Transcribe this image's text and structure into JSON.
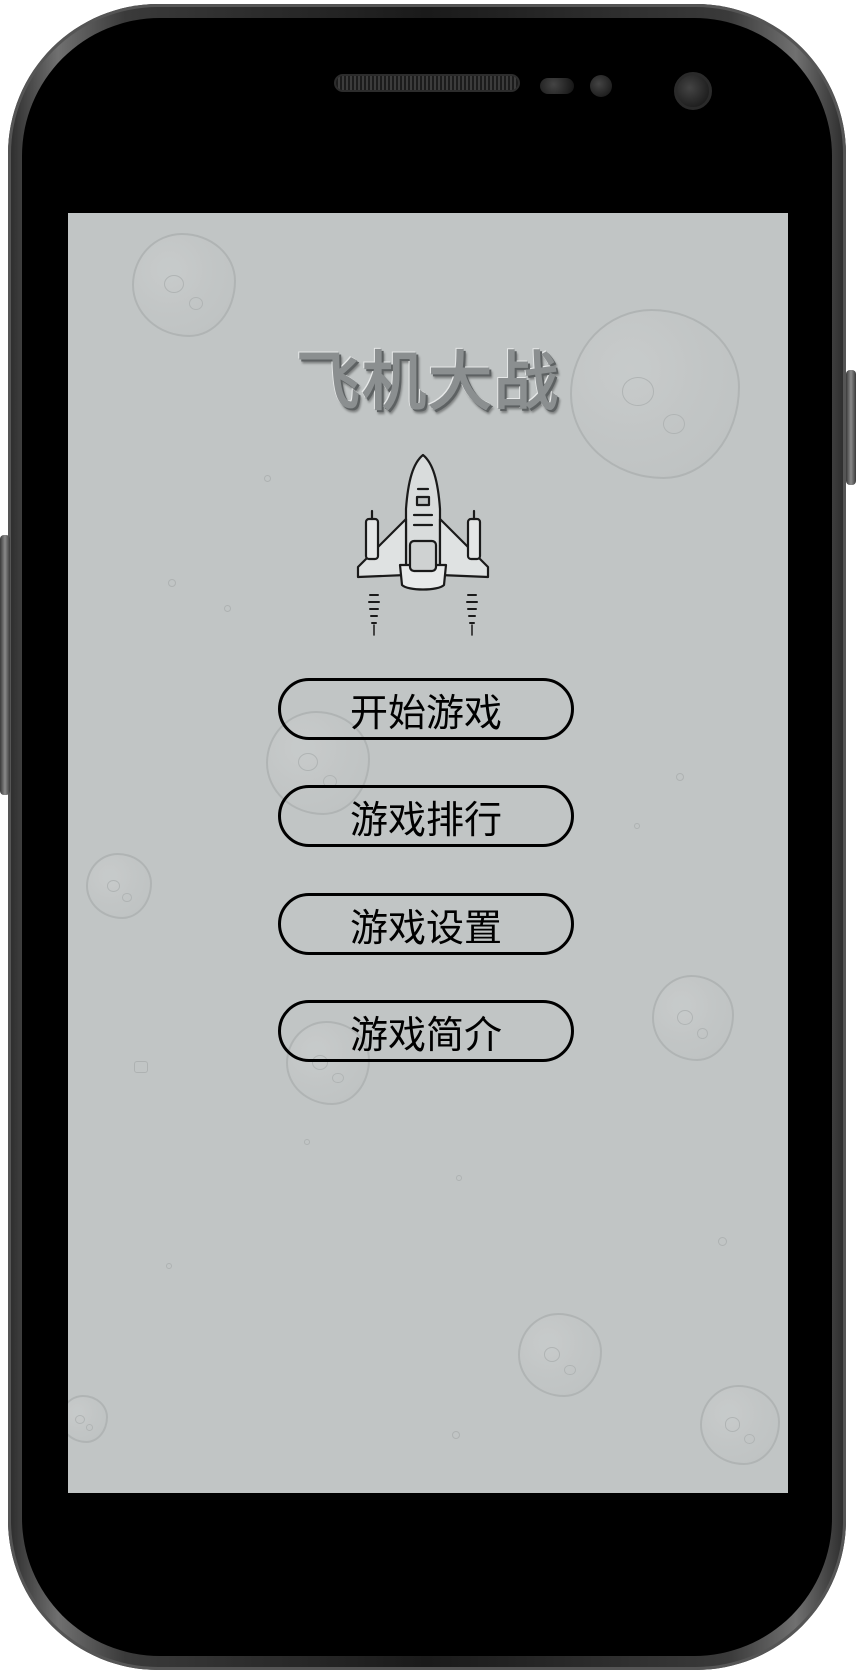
{
  "app": {
    "title": "飞机大战"
  },
  "menu": {
    "start": "开始游戏",
    "ranking": "游戏排行",
    "settings": "游戏设置",
    "intro": "游戏简介"
  },
  "colors": {
    "screen_background": "#c1c5c5",
    "title_fill": "#8b8f90",
    "button_border": "#000000",
    "phone_body": "#1a1a1a"
  },
  "icons": {
    "hero": "fighter-jet-icon",
    "background": "asteroid-icon"
  }
}
